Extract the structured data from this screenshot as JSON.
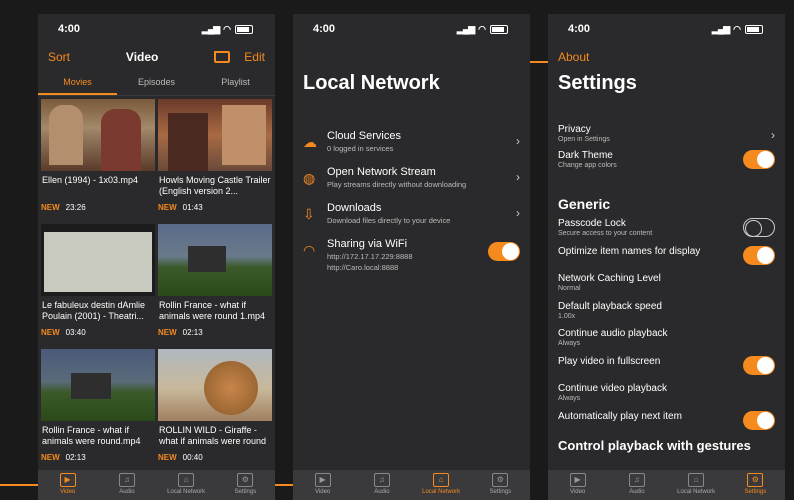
{
  "status": {
    "time": "4:00"
  },
  "video_screen": {
    "sort": "Sort",
    "title": "Video",
    "edit": "Edit",
    "tabs": [
      "Movies",
      "Episodes",
      "Playlist"
    ],
    "items": [
      {
        "caption": "Ellen (1994) - 1x03.mp4",
        "badge": "NEW",
        "duration": "23:26"
      },
      {
        "caption": "Howls Moving Castle Trailer (English version 2...",
        "badge": "NEW",
        "duration": "01:43"
      },
      {
        "caption": "Le fabuleux destin dAmlie Poulain (2001) - Theatri...",
        "badge": "NEW",
        "duration": "03:40"
      },
      {
        "caption": "Rollin France - what if animals were round 1.mp4",
        "badge": "NEW",
        "duration": "02:13"
      },
      {
        "caption": "Rollin France - what if animals were round.mp4",
        "badge": "NEW",
        "duration": "02:13"
      },
      {
        "caption": "ROLLIN WILD - Giraffe - what if animals were round",
        "badge": "NEW",
        "duration": "00:40"
      }
    ]
  },
  "network_screen": {
    "title": "Local Network",
    "rows": [
      {
        "title": "Cloud Services",
        "subtitle": "0 logged in services"
      },
      {
        "title": "Open Network Stream",
        "subtitle": "Play streams directly without downloading"
      },
      {
        "title": "Downloads",
        "subtitle": "Download files directly to your device"
      }
    ],
    "sharing": {
      "title": "Sharing via WiFi",
      "line1": "http://172.17.17.229:8888",
      "line2": "http://Caro.local:8888",
      "on": true
    }
  },
  "settings_screen": {
    "about": "About",
    "title": "Settings",
    "privacy": {
      "title": "Privacy",
      "subtitle": "Open in Settings"
    },
    "dark": {
      "title": "Dark Theme",
      "subtitle": "Change app colors"
    },
    "generic": "Generic",
    "rows": [
      {
        "title": "Passcode Lock",
        "subtitle": "Secure access to your content",
        "toggle": "off"
      },
      {
        "title": "Optimize item names for display",
        "subtitle": "",
        "toggle": "on"
      },
      {
        "title": "Network Caching Level",
        "subtitle": "Normal",
        "toggle": ""
      },
      {
        "title": "Default playback speed",
        "subtitle": "1.00x",
        "toggle": ""
      },
      {
        "title": "Continue audio playback",
        "subtitle": "Always",
        "toggle": ""
      },
      {
        "title": "Play video in fullscreen",
        "subtitle": "",
        "toggle": "on"
      },
      {
        "title": "Continue video playback",
        "subtitle": "Always",
        "toggle": ""
      },
      {
        "title": "Automatically play next item",
        "subtitle": "",
        "toggle": "on"
      }
    ],
    "cutoff": "Control playback with gestures"
  },
  "tabbar": [
    "Video",
    "Audio",
    "Local Network",
    "Settings"
  ],
  "accent": "#f58a1f"
}
